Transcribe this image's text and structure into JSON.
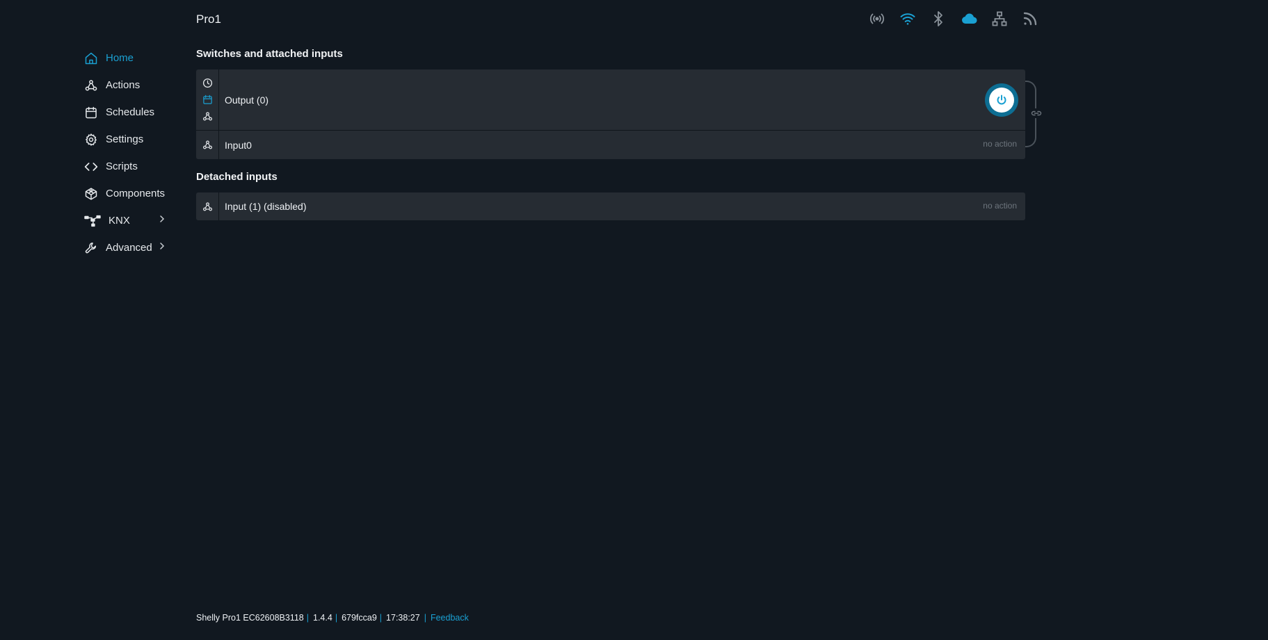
{
  "header": {
    "device_name": "Pro1",
    "status_icons": [
      "antenna-icon",
      "wifi-icon",
      "bluetooth-icon",
      "cloud-icon",
      "ethernet-icon",
      "rss-icon"
    ]
  },
  "sidebar": {
    "items": [
      {
        "label": "Home",
        "icon": "home-icon",
        "active": true
      },
      {
        "label": "Actions",
        "icon": "webhook-icon"
      },
      {
        "label": "Schedules",
        "icon": "calendar-icon"
      },
      {
        "label": "Settings",
        "icon": "gear-icon"
      },
      {
        "label": "Scripts",
        "icon": "code-icon"
      },
      {
        "label": "Components",
        "icon": "components-icon"
      },
      {
        "label": "KNX",
        "icon": "knx-icon",
        "expandable": true
      },
      {
        "label": "Advanced",
        "icon": "wrench-icon",
        "expandable": true
      }
    ]
  },
  "main": {
    "section_switches": "Switches and attached inputs",
    "output_label": "Output (0)",
    "input0_label": "Input0",
    "input0_action": "no action",
    "section_detached": "Detached inputs",
    "input1_label": "Input (1) (disabled)",
    "input1_action": "no action"
  },
  "footer": {
    "device_id": "Shelly Pro1 EC62608B3118",
    "version": "1.4.4",
    "build": "679fcca9",
    "time": "17:38:27",
    "feedback": "Feedback"
  },
  "colors": {
    "background": "#111820",
    "card": "#262c33",
    "accent": "#1aa0d2",
    "muted": "#6d757d"
  }
}
